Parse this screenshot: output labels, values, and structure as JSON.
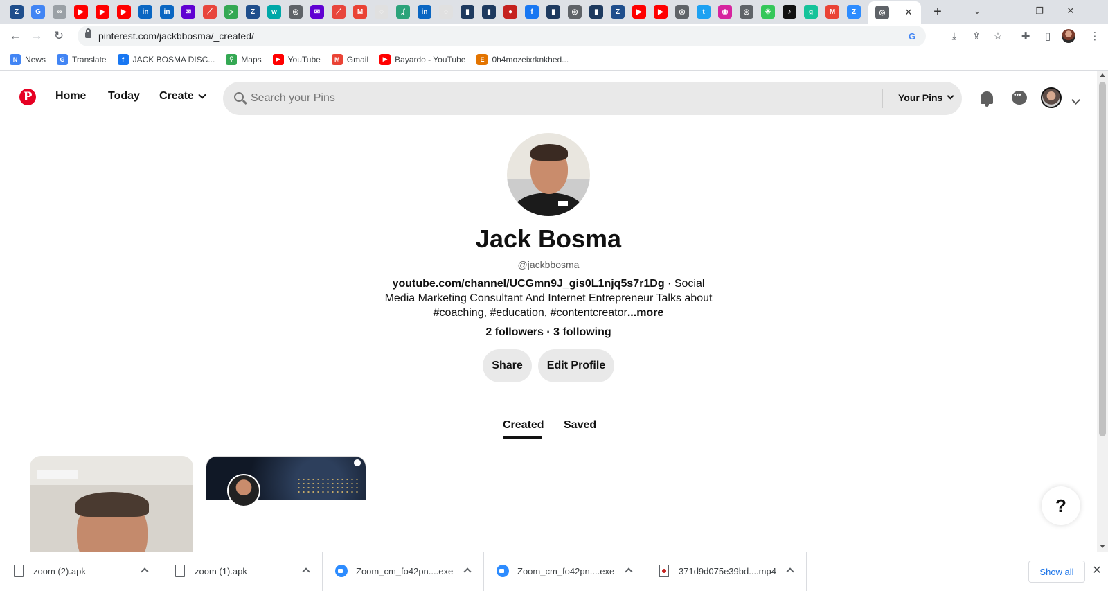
{
  "browser": {
    "tab_favicons": [
      {
        "name": "zoom-meeting-tab",
        "color": "#1f4e8c",
        "glyph": "Z"
      },
      {
        "name": "google-tab",
        "color": "#4285f4",
        "glyph": "G"
      },
      {
        "name": "link-tab",
        "color": "#9aa0a6",
        "glyph": "∞"
      },
      {
        "name": "youtube-tab",
        "color": "#ff0000",
        "glyph": "▶"
      },
      {
        "name": "youtube-tab",
        "color": "#ff0000",
        "glyph": "▶"
      },
      {
        "name": "youtube-tab",
        "color": "#ff0000",
        "glyph": "▶"
      },
      {
        "name": "linkedin-tab",
        "color": "#0a66c2",
        "glyph": "in"
      },
      {
        "name": "linkedin-tab",
        "color": "#0a66c2",
        "glyph": "in"
      },
      {
        "name": "yahoo-mail-tab",
        "color": "#6001d2",
        "glyph": "✉"
      },
      {
        "name": "app-tab",
        "color": "#e8453c",
        "glyph": "⟋"
      },
      {
        "name": "play-tab",
        "color": "#34a853",
        "glyph": "▷"
      },
      {
        "name": "zoom-meeting-tab",
        "color": "#1f4e8c",
        "glyph": "Z"
      },
      {
        "name": "wattpad-tab",
        "color": "#00a8a8",
        "glyph": "w"
      },
      {
        "name": "chrome-tab",
        "color": "#5f6368",
        "glyph": "◎"
      },
      {
        "name": "yahoo-mail-tab",
        "color": "#6001d2",
        "glyph": "✉"
      },
      {
        "name": "app-tab",
        "color": "#e8453c",
        "glyph": "⟋"
      },
      {
        "name": "gmail-tab",
        "color": "#ea4335",
        "glyph": "M"
      },
      {
        "name": "blank-tab",
        "color": "#e0e0e0",
        "glyph": "◌"
      },
      {
        "name": "stumble-tab",
        "color": "#2ba37a",
        "glyph": "ʆ"
      },
      {
        "name": "linkedin-tab",
        "color": "#0a66c2",
        "glyph": "in"
      },
      {
        "name": "blank-tab",
        "color": "#e0e0e0",
        "glyph": "◌"
      },
      {
        "name": "dark-tab",
        "color": "#1e3a5f",
        "glyph": "▮"
      },
      {
        "name": "dark-tab",
        "color": "#1e3a5f",
        "glyph": "▮"
      },
      {
        "name": "record-tab",
        "color": "#c5221f",
        "glyph": "●"
      },
      {
        "name": "facebook-tab",
        "color": "#1877f2",
        "glyph": "f"
      },
      {
        "name": "dark-tab",
        "color": "#1e3a5f",
        "glyph": "▮"
      },
      {
        "name": "chrome-tab",
        "color": "#5f6368",
        "glyph": "◎"
      },
      {
        "name": "dark-tab",
        "color": "#1e3a5f",
        "glyph": "▮"
      },
      {
        "name": "zoom-meeting-tab",
        "color": "#1f4e8c",
        "glyph": "Z"
      },
      {
        "name": "youtube-tab",
        "color": "#ff0000",
        "glyph": "▶"
      },
      {
        "name": "youtube-tab",
        "color": "#ff0000",
        "glyph": "▶"
      },
      {
        "name": "chrome-tab",
        "color": "#5f6368",
        "glyph": "◎"
      },
      {
        "name": "twitter-tab",
        "color": "#1da1f2",
        "glyph": "t"
      },
      {
        "name": "instagram-tab",
        "color": "#d6249f",
        "glyph": "◉"
      },
      {
        "name": "chrome-tab",
        "color": "#5f6368",
        "glyph": "◎"
      },
      {
        "name": "star-tab",
        "color": "#34c759",
        "glyph": "✳"
      },
      {
        "name": "tiktok-tab",
        "color": "#111111",
        "glyph": "♪"
      },
      {
        "name": "grammarly-tab",
        "color": "#15c39a",
        "glyph": "g"
      },
      {
        "name": "gmail-tab",
        "color": "#ea4335",
        "glyph": "M"
      },
      {
        "name": "zoom-tab",
        "color": "#2d8cff",
        "glyph": "Z"
      }
    ],
    "active_tab_favicon": {
      "name": "chrome-tab",
      "color": "#5f6368",
      "glyph": "◎"
    },
    "url": "pinterest.com/jackbbosma/_created/",
    "bookmarks": [
      {
        "label": "News",
        "color": "#4285f4",
        "glyph": "N"
      },
      {
        "label": "Translate",
        "color": "#4285f4",
        "glyph": "G"
      },
      {
        "label": "JACK BOSMA DISC...",
        "color": "#1877f2",
        "glyph": "f"
      },
      {
        "label": "Maps",
        "color": "#34a853",
        "glyph": "⚲"
      },
      {
        "label": "YouTube",
        "color": "#ff0000",
        "glyph": "▶"
      },
      {
        "label": "Gmail",
        "color": "#ea4335",
        "glyph": "M"
      },
      {
        "label": "Bayardo - YouTube",
        "color": "#ff0000",
        "glyph": "▶"
      },
      {
        "label": "0h4mozeixrknkhed...",
        "color": "#e37400",
        "glyph": "E"
      }
    ]
  },
  "pinterest": {
    "logo": "P",
    "nav": {
      "home": "Home",
      "today": "Today",
      "create": "Create"
    },
    "search_placeholder": "Search your Pins",
    "your_pins": "Your Pins",
    "accent_color": "#e60023"
  },
  "profile": {
    "name": "Jack Bosma",
    "handle": "@jackbbosma",
    "bio_link": "youtube.com/channel/UCGmn9J_gis0L1njq5s7r1Dg",
    "bio_text": " · Social Media Marketing Consultant And Internet Entrepreneur Talks about #coaching, #education, #contentcreator",
    "bio_more": "...more",
    "follow_stats": "2 followers · 3 following",
    "share_button": "Share",
    "edit_button": "Edit Profile",
    "tabs": [
      "Created",
      "Saved"
    ],
    "active_tab": "Created"
  },
  "help_button": "?",
  "downloads": [
    {
      "name": "zoom (2).apk",
      "type": "file"
    },
    {
      "name": "zoom (1).apk",
      "type": "file"
    },
    {
      "name": "Zoom_cm_fo42pn....exe",
      "type": "zoom"
    },
    {
      "name": "Zoom_cm_fo42pn....exe",
      "type": "zoom"
    },
    {
      "name": "371d9d075e39bd....mp4",
      "type": "mp4"
    }
  ],
  "show_all": "Show all"
}
